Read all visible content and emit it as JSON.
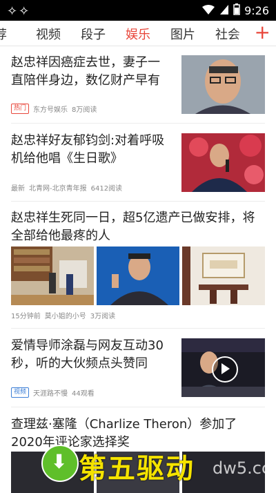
{
  "status_bar": {
    "time": "9:26"
  },
  "tabs": [
    "推荐",
    "视频",
    "段子",
    "娱乐",
    "图片",
    "社会"
  ],
  "tabs_visible": [
    "荐",
    "视频",
    "段子",
    "娱乐",
    "图片",
    "社会"
  ],
  "active_tab": "娱乐",
  "add_icon": "+",
  "articles": [
    {
      "title": "赵忠祥因癌症去世，妻子一直陪伴身边，数亿财产早有",
      "badge": "热门",
      "source": "东方号娱乐",
      "reads": "8万阅读"
    },
    {
      "title": "赵忠祥好友郁钧剑:对着呼吸机给他唱《生日歌》",
      "time": "最新",
      "source": "北青网-北京青年报",
      "reads": "6412阅读"
    },
    {
      "title": "赵忠祥生死同一日，超5亿遗产已做安排，将全部给他最疼的人",
      "time": "15分钟前",
      "source": "莫小姐的小号",
      "reads": "3万阅读"
    },
    {
      "title": "爱情导师涂磊与网友互动30秒，听的大伙频点头赞同",
      "badge": "视频",
      "source": "天涯路不慢",
      "reads": "44观看"
    },
    {
      "title": "查理兹·塞隆（Charlize Theron）参加了2020年评论家选择奖"
    }
  ],
  "watermark": {
    "text": "第五驱动",
    "url": "dw5.cc"
  },
  "colors": {
    "accent": "#e8463a",
    "video_badge": "#3d7fd6"
  }
}
